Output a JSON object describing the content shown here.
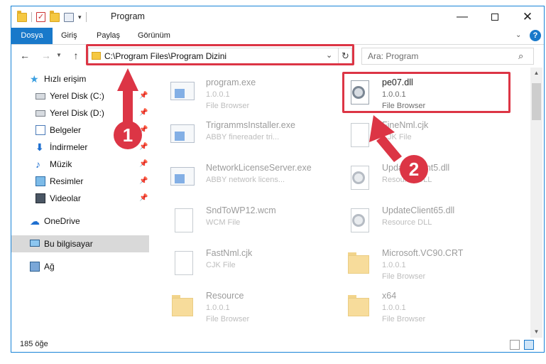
{
  "window": {
    "title": "Program",
    "controls": {
      "minimize": "—",
      "maximize": "",
      "close": "✕"
    }
  },
  "ribbon": {
    "tabs": [
      "Dosya",
      "Giriş",
      "Paylaş",
      "Görünüm"
    ],
    "help": "?"
  },
  "nav": {
    "address": "C:\\Program Files\\Program Dizini",
    "search_placeholder": "Ara: Program"
  },
  "sidebar": {
    "items": [
      {
        "label": "Hızlı erişim",
        "icon": "star-icon"
      },
      {
        "label": "Yerel Disk (C:)",
        "icon": "disk-icon",
        "pinned": true
      },
      {
        "label": "Yerel Disk (D:)",
        "icon": "disk-icon",
        "pinned": true
      },
      {
        "label": "Belgeler",
        "icon": "documents-icon",
        "pinned": true
      },
      {
        "label": "İndirmeler",
        "icon": "download-icon",
        "pinned": true
      },
      {
        "label": "Müzik",
        "icon": "music-icon",
        "pinned": true
      },
      {
        "label": "Resimler",
        "icon": "pictures-icon",
        "pinned": true
      },
      {
        "label": "Videolar",
        "icon": "videos-icon",
        "pinned": true
      },
      {
        "label": "OneDrive",
        "icon": "onedrive-icon"
      },
      {
        "label": "Bu bilgisayar",
        "icon": "computer-icon",
        "selected": true
      },
      {
        "label": "Ağ",
        "icon": "network-icon"
      }
    ]
  },
  "files": [
    {
      "name": "program.exe",
      "line2": "1.0.0.1",
      "line3": "File Browser",
      "icon": "exe-icon"
    },
    {
      "name": "pe07.dll",
      "line2": "1.0.0.1",
      "line3": "File Browser",
      "icon": "dll-gear-icon"
    },
    {
      "name": "TrigrammsInstaller.exe",
      "line2": "ABBY finereader tri...",
      "line3": "",
      "icon": "exe-icon"
    },
    {
      "name": "FineNml.cjk",
      "line2": "CJK File",
      "line3": "",
      "icon": "file-icon"
    },
    {
      "name": "NetworkLicenseServer.exe",
      "line2": "ABBY network licens...",
      "line3": "",
      "icon": "exe-icon"
    },
    {
      "name": "UpdateClient5.dll",
      "line2": "Resource DLL",
      "line3": "",
      "icon": "dll-gear-icon"
    },
    {
      "name": "SndToWP12.wcm",
      "line2": "WCM File",
      "line3": "",
      "icon": "file-icon"
    },
    {
      "name": "UpdateClient65.dll",
      "line2": "Resource DLL",
      "line3": "",
      "icon": "dll-gear-icon"
    },
    {
      "name": "FastNml.cjk",
      "line2": "CJK File",
      "line3": "",
      "icon": "file-icon"
    },
    {
      "name": "Microsoft.VC90.CRT",
      "line2": "1.0.0.1",
      "line3": "File Browser",
      "icon": "folder-icon"
    },
    {
      "name": "Resource",
      "line2": "1.0.0.1",
      "line3": "File Browser",
      "icon": "folder-icon"
    },
    {
      "name": "x64",
      "line2": "1.0.0.1",
      "line3": "File Browser",
      "icon": "folder-icon"
    }
  ],
  "status": {
    "count_text": "185 öğe"
  },
  "annotations": {
    "step1": "1",
    "step2": "2",
    "color": "#dc3545"
  }
}
